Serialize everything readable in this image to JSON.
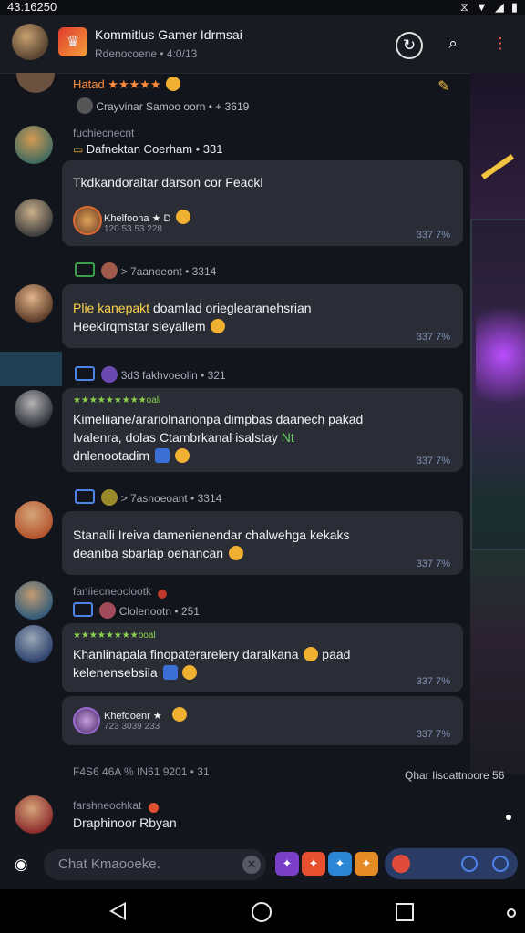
{
  "status": {
    "time": "43:16250"
  },
  "header": {
    "title": "Kommitlus Gamer Idrmsai",
    "subtitle": "Rdenocoene • 4:0/13"
  },
  "top_item": {
    "stars_label": "Hatad ★★★★★",
    "line": "Crayvinar Samoo oorn  • + 3619"
  },
  "messages": [
    {
      "meta": "fuchiecnecnt",
      "name": "Dafnektan Coerham  • 331",
      "text": "Tkdkandoraitar darson cor Feackl",
      "reply_name": "Khelfoona ★ D",
      "reply_date": "120 53 53 228",
      "ts": "337 7%"
    },
    {
      "meta": "> 7aanoeont  • 3314",
      "text_hl": "Plie kanepakt",
      "text": "doamlad orieglearanehsrian\nHeekirqmstar sieyallem",
      "ts": "337 7%"
    },
    {
      "meta": "3d3 fakhvoeolin  • 321",
      "stars": "★★★★★★★★★oali",
      "text": "Kimeliiane/arariolnarionpa dimpbas daanech pakad\nIvalenra, dolas Ctambrkanal isalstay",
      "link": "Nt",
      "text2": "dnlenootadim",
      "ts": "337 7%"
    },
    {
      "meta": "> 7asnoeoant  • 3314",
      "text": "Stanalli Ireiva damenienendar chalwehga kekaks\ndeaniba sbarlap oenancan",
      "ts": "337 7%"
    },
    {
      "meta": "faniiecneoclootk",
      "sub": "Clolenootn  • 251",
      "stars": "★★★★★★★★ooal",
      "text": "Khanlinapala finopaterarelery daralkana",
      "text_tail": "paad",
      "text2": "kelenensebsila",
      "ts": "337 7%"
    },
    {
      "reply_name": "Khefdoenr ★",
      "reply_date": "723 3039 233",
      "ts": "337 7%"
    }
  ],
  "footer_line": {
    "left": "F4S6  46A  % IN61  9201  • 31",
    "right": "Qhar Iisoattnoore  56"
  },
  "last_item": {
    "meta": "farshneochkat",
    "name": "Draphinoor Rbyan"
  },
  "input": {
    "placeholder": "Chat Kmaooeke."
  },
  "colors": {
    "accent": "#4c84e8",
    "bubble": "#2a2c36",
    "background": "#13151c"
  }
}
